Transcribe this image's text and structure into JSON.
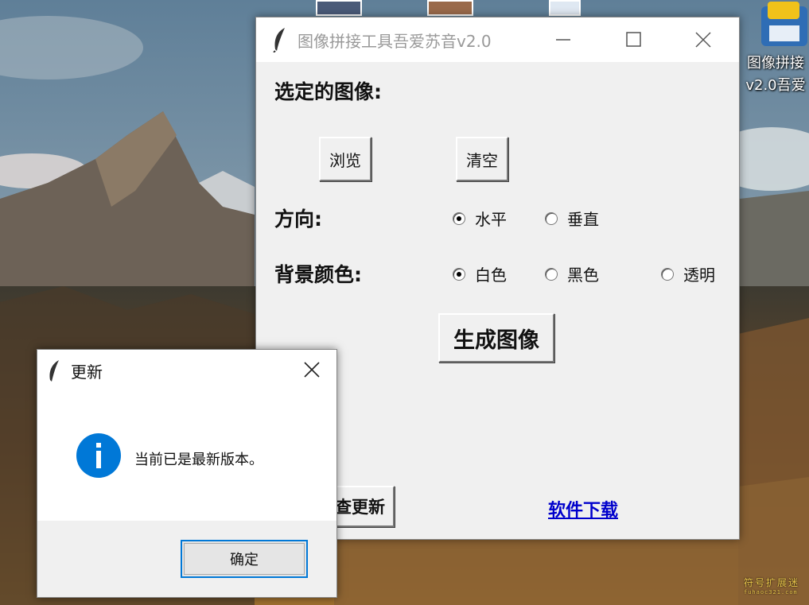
{
  "desktop": {
    "icon_label": "图像拼接\nv2.0吾爱",
    "watermark_main": "符号扩展迷",
    "watermark_sub": "fuhaoc321.com"
  },
  "main_window": {
    "title": "图像拼接工具吾爱苏音v2.0",
    "selected_images_label": "选定的图像:",
    "browse_button": "浏览",
    "clear_button": "清空",
    "direction_label": "方向:",
    "direction_options": [
      {
        "label": "水平",
        "selected": true
      },
      {
        "label": "垂直",
        "selected": false
      }
    ],
    "bg_color_label": "背景颜色:",
    "bg_color_options": [
      {
        "label": "白色",
        "selected": true
      },
      {
        "label": "黑色",
        "selected": false
      },
      {
        "label": "透明",
        "selected": false
      }
    ],
    "generate_button": "生成图像",
    "check_update_button": "检查更新",
    "check_update_visible": "查更新",
    "download_link": "软件下载"
  },
  "dialog": {
    "title": "更新",
    "message": "当前已是最新版本。",
    "ok_button": "确定",
    "icon": "info-icon"
  },
  "colors": {
    "link": "#0000cc",
    "info_blue": "#0078d7",
    "dialog_ok_border": "#0078d7"
  }
}
